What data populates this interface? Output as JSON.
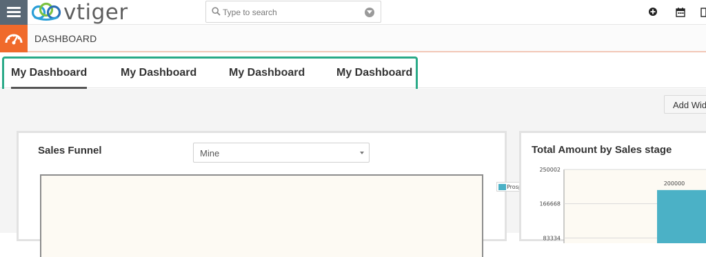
{
  "app": {
    "logo_text": "vtiger"
  },
  "search": {
    "placeholder": "Type to search"
  },
  "header": {
    "title": "DASHBOARD"
  },
  "tabs": [
    {
      "label": "My Dashboard",
      "active": true
    },
    {
      "label": "My Dashboard",
      "active": false
    },
    {
      "label": "My Dashboard",
      "active": false
    },
    {
      "label": "My Dashboard",
      "active": false
    }
  ],
  "toolbar": {
    "add_widget_label": "Add Widget"
  },
  "widgets": {
    "sales_funnel": {
      "title": "Sales Funnel",
      "filter_value": "Mine",
      "legend": "Prospecting"
    },
    "total_amount": {
      "title": "Total Amount by Sales stage"
    }
  },
  "colors": {
    "accent": "#f06a2b",
    "tab_highlight": "#2aaa88",
    "series": "#4bb1c6"
  },
  "chart_data": {
    "type": "bar",
    "title": "Total Amount by Sales stage",
    "series": [
      {
        "values": [
          200000
        ]
      }
    ],
    "data_labels": [
      "200000"
    ],
    "yticks": [
      "250002",
      "166668",
      "83334"
    ],
    "ylim": [
      0,
      250002
    ],
    "grid": true
  }
}
